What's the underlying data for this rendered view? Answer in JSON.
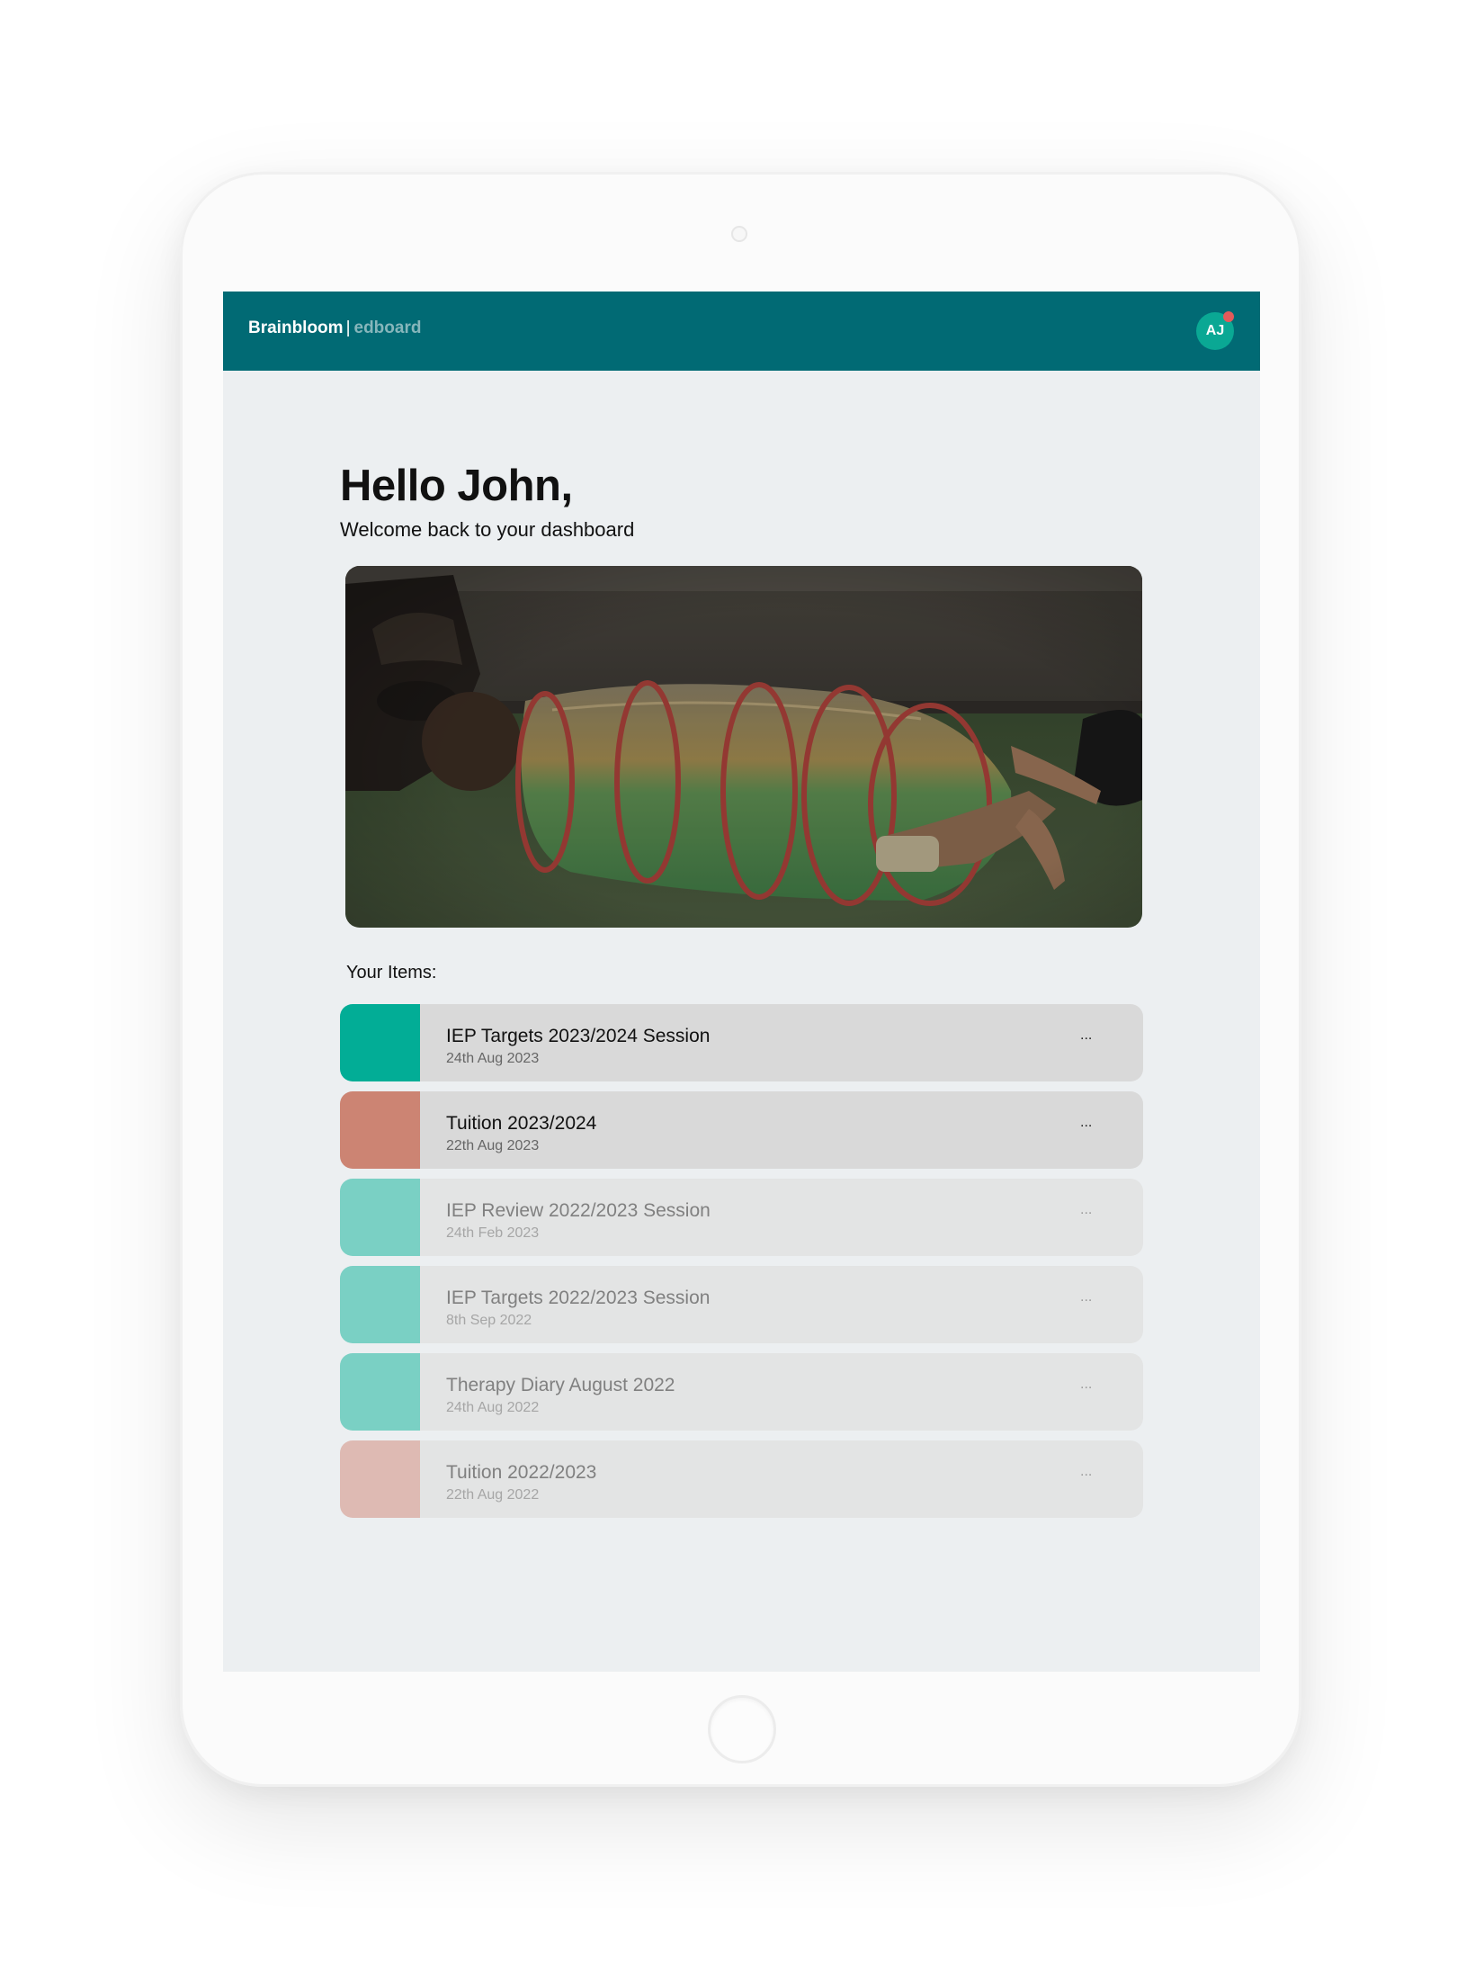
{
  "navbar": {
    "brand_name": "Brainbloom",
    "brand_separator": "|",
    "brand_product": "edboard",
    "avatar_initials": "AJ",
    "background_color": "#016a74",
    "notification_dot_color": "#e45a5a"
  },
  "dashboard": {
    "greeting": "Hello John,",
    "subtitle": "Welcome back to your dashboard",
    "hero_image": "child crawling through a colorful play tunnel on grass",
    "items_heading": "Your Items:"
  },
  "items": [
    {
      "title": "IEP Targets 2023/2024 Session",
      "date": "24th Aug 2023",
      "menu": "...",
      "color": "#02ad96",
      "state": "active"
    },
    {
      "title": "Tuition 2023/2024",
      "date": "22th Aug 2023",
      "menu": "...",
      "color": "#cc8473",
      "state": "active"
    },
    {
      "title": "IEP Review 2022/2023 Session",
      "date": "24th Feb 2023",
      "menu": "...",
      "color": "#7ad0c4",
      "state": "faded"
    },
    {
      "title": "IEP Targets 2022/2023 Session",
      "date": "8th Sep 2022",
      "menu": "...",
      "color": "#7ad0c4",
      "state": "faded"
    },
    {
      "title": "Therapy Diary August 2022",
      "date": "24th Aug 2022",
      "menu": "...",
      "color": "#7ad0c4",
      "state": "faded"
    },
    {
      "title": "Tuition 2022/2023",
      "date": "22th Aug 2022",
      "menu": "...",
      "color": "#debab3",
      "state": "faded"
    }
  ]
}
